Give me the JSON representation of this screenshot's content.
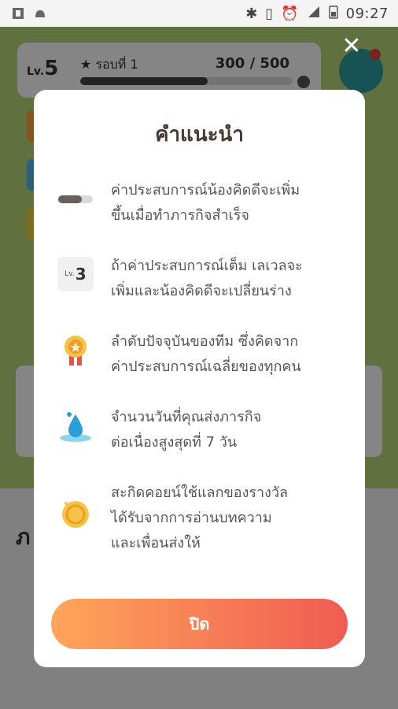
{
  "status_bar": {
    "time": "09:27",
    "network": "R"
  },
  "background": {
    "level_label": "Lv.",
    "level_value": "5",
    "rank_label": "รอบที่",
    "rank_value": "1",
    "xp_text": "300",
    "xp_max": "500",
    "xp_progress": 0.6,
    "section_heading": "ภ"
  },
  "dialog": {
    "title": "คำแนะนำ",
    "items": [
      {
        "icon": "experience-bar-icon",
        "text": "ค่าประสบการณ์น้องคิดดีจะเพิ่ม\nขึ้นเมื่อทำภารกิจสำเร็จ"
      },
      {
        "icon": "level-badge-icon",
        "icon_label": "Lv.",
        "icon_value": "3",
        "text": "ถ้าค่าประสบการณ์เต็ม เลเวลจะ\nเพิ่มและน้องคิดดีจะเปลี่ยนร่าง"
      },
      {
        "icon": "medal-icon",
        "text": "ลำดับปัจจุบันของทีม ซึ่งคิดจาก\nค่าประสบการณ์เฉลี่ยของทุกคน"
      },
      {
        "icon": "water-drop-icon",
        "text": "จำนวนวันที่คุณส่งภารกิจ\nต่อเนื่องสูงสุดที่ 7 วัน"
      },
      {
        "icon": "coin-icon",
        "text": "สะกิดคอยน์ใช้แลกของรางวัล\nได้รับจากการอ่านบทความ\nและเพื่อนส่งให้"
      }
    ],
    "close_button_label": "ปิด"
  },
  "colors": {
    "title": "#4a3a33",
    "button_start": "#ffa55a",
    "button_end": "#ef5c52",
    "chat_button": "#2d9ea3"
  }
}
